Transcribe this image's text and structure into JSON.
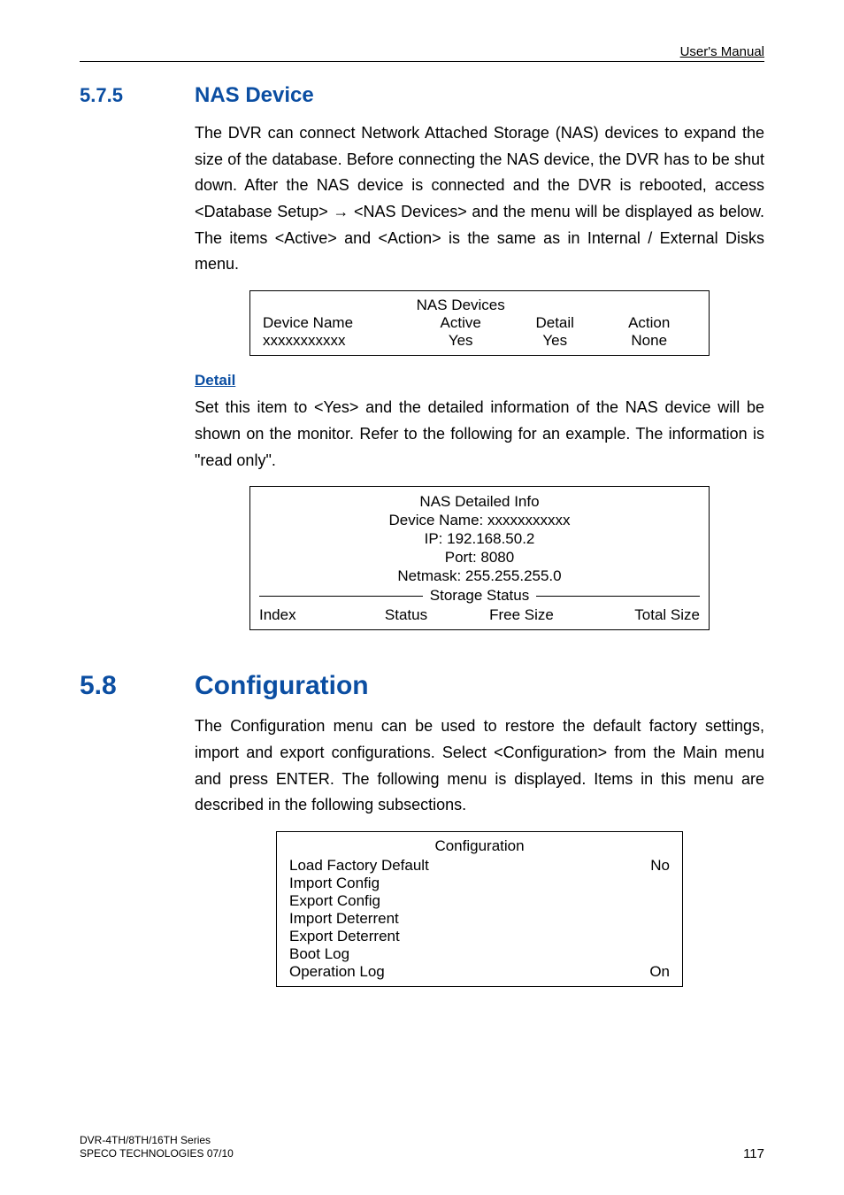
{
  "header": {
    "right": "User's Manual"
  },
  "sec_nas": {
    "num": "5.7.5",
    "title": "NAS Device",
    "para1": "The DVR can connect Network Attached Storage (NAS) devices to expand the size of the database. Before connecting the NAS device, the DVR has to be shut down. After the NAS device is connected and the DVR is rebooted, access <Database Setup> → <NAS Devices> and the menu will be displayed as below. The items <Active> and <Action> is the same as in Internal / External Disks menu."
  },
  "nas_table": {
    "title": "NAS Devices",
    "headers": [
      "Device Name",
      "Active",
      "Detail",
      "Action"
    ],
    "row": [
      "xxxxxxxxxxx",
      "Yes",
      "Yes",
      "None"
    ]
  },
  "detail_sec": {
    "heading": "Detail",
    "para": "Set this item to <Yes> and the detailed information of the NAS device will be shown on the monitor. Refer to the following for an example. The information is \"read only\"."
  },
  "detail_box": {
    "title": "NAS Detailed Info",
    "devname": "Device Name: xxxxxxxxxxx",
    "ip": "IP: 192.168.50.2",
    "port": "Port: 8080",
    "netmask": "Netmask: 255.255.255.0",
    "storage_status": "Storage Status",
    "cols": [
      "Index",
      "Status",
      "Free Size",
      "Total Size"
    ]
  },
  "sec_config": {
    "num": "5.8",
    "title": "Configuration",
    "para": "The Configuration menu can be used to restore the default factory settings, import and export configurations. Select <Configuration> from the Main menu and press ENTER. The following menu is displayed. Items in this menu are described in the following subsections."
  },
  "config_box": {
    "title": "Configuration",
    "rows": [
      {
        "label": "Load Factory Default",
        "value": "No"
      },
      {
        "label": "Import Config",
        "value": ""
      },
      {
        "label": "Export Config",
        "value": ""
      },
      {
        "label": "Import Deterrent",
        "value": ""
      },
      {
        "label": "Export Deterrent",
        "value": ""
      },
      {
        "label": "Boot Log",
        "value": ""
      },
      {
        "label": "Operation Log",
        "value": "On"
      }
    ]
  },
  "footer": {
    "left1": "DVR-4TH/8TH/16TH Series",
    "left2": "SPECO TECHNOLOGIES 07/10",
    "page": "117"
  }
}
